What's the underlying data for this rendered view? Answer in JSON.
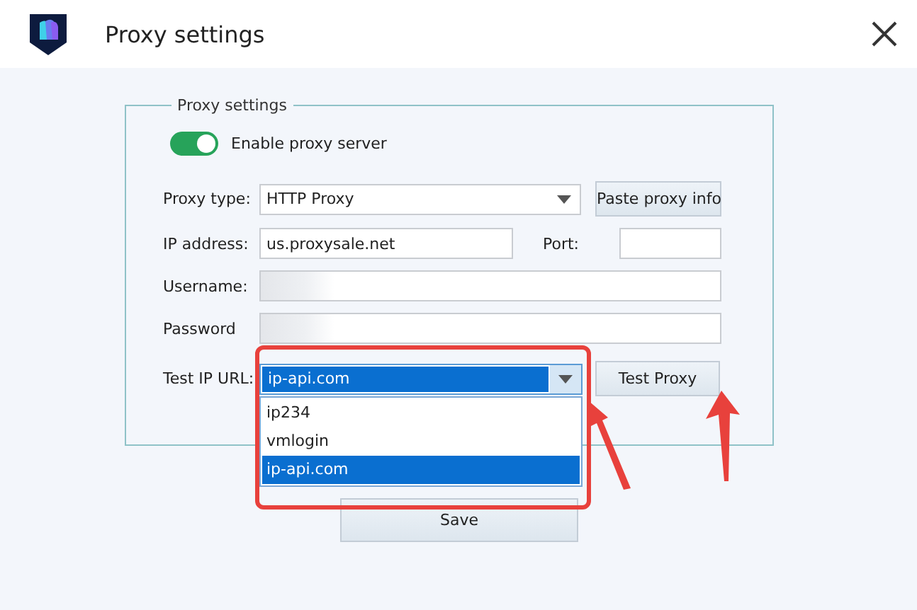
{
  "window": {
    "title": "Proxy settings"
  },
  "group": {
    "title": "Proxy settings"
  },
  "enable_proxy": {
    "label": "Enable proxy server",
    "on": true
  },
  "proxy_type": {
    "label": "Proxy type:",
    "value": "HTTP Proxy"
  },
  "paste_button": "Paste proxy info",
  "ip_address": {
    "label": "IP address:",
    "value": "us.proxysale.net"
  },
  "port": {
    "label": "Port:"
  },
  "username": {
    "label": "Username:"
  },
  "password": {
    "label": "Password"
  },
  "test_url": {
    "label": "Test IP URL:",
    "value": "ip-api.com",
    "expanded": true,
    "options": [
      {
        "label": "ip234",
        "selected": false
      },
      {
        "label": "vmlogin",
        "selected": false
      },
      {
        "label": "ip-api.com",
        "selected": true
      }
    ]
  },
  "test_button": "Test Proxy",
  "save_button": "Save"
}
